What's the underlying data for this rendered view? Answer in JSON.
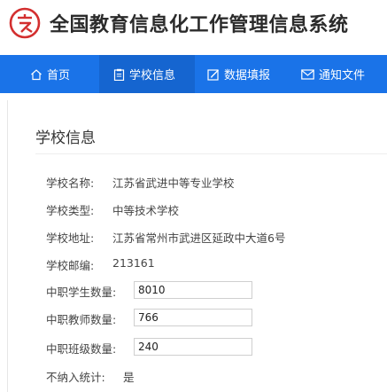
{
  "app": {
    "title": "全国教育信息化工作管理信息系统",
    "brand_color": "#d32f2f"
  },
  "nav": {
    "bar_color": "#1a73e8",
    "items": [
      {
        "label": "首页",
        "icon": "home-icon",
        "active": false
      },
      {
        "label": "学校信息",
        "icon": "clipboard-icon",
        "active": true
      },
      {
        "label": "数据填报",
        "icon": "edit-icon",
        "active": false
      },
      {
        "label": "通知文件",
        "icon": "mail-icon",
        "active": false
      }
    ]
  },
  "section": {
    "title": "学校信息"
  },
  "school": {
    "name_label": "学校名称:",
    "name_value": "江苏省武进中等专业学校",
    "type_label": "学校类型:",
    "type_value": "中等技术学校",
    "address_label": "学校地址:",
    "address_value": "江苏省常州市武进区延政中大道6号",
    "postcode_label": "学校邮编:",
    "postcode_value": "213161",
    "students_label": "中职学生数量:",
    "students_value": "8010",
    "teachers_label": "中职教师数量:",
    "teachers_value": "766",
    "classes_label": "中职班级数量:",
    "classes_value": "240",
    "exclude_label": "不纳入统计:",
    "exclude_value": "是"
  }
}
